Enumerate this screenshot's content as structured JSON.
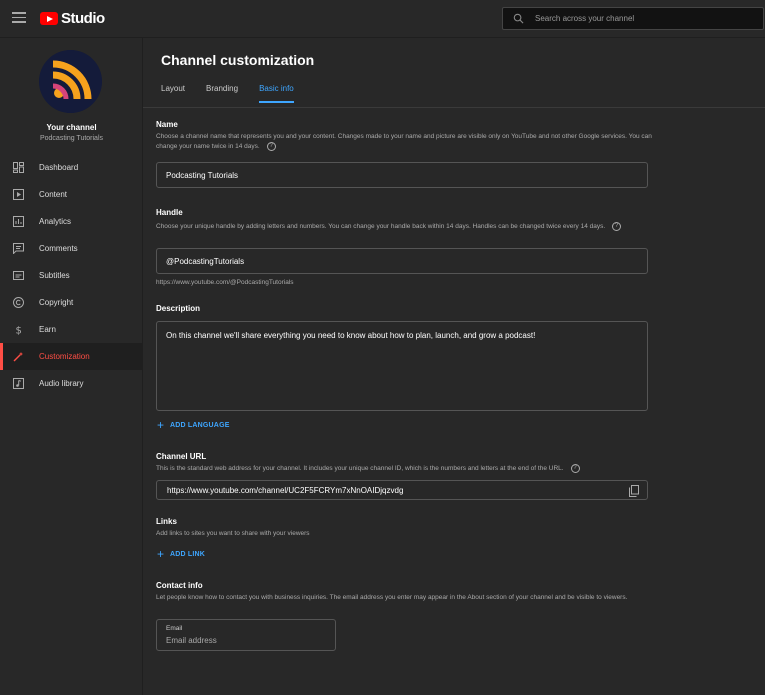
{
  "app": {
    "logo_text": "Studio"
  },
  "search": {
    "placeholder": "Search across your channel"
  },
  "sidebar": {
    "channel_title": "Your channel",
    "channel_name": "Podcasting Tutorials",
    "items": [
      {
        "label": "Dashboard",
        "icon": "dashboard-icon"
      },
      {
        "label": "Content",
        "icon": "content-icon"
      },
      {
        "label": "Analytics",
        "icon": "analytics-icon"
      },
      {
        "label": "Comments",
        "icon": "comments-icon"
      },
      {
        "label": "Subtitles",
        "icon": "subtitles-icon"
      },
      {
        "label": "Copyright",
        "icon": "copyright-icon"
      },
      {
        "label": "Earn",
        "icon": "earn-icon"
      },
      {
        "label": "Customization",
        "icon": "customization-icon",
        "active": true
      },
      {
        "label": "Audio library",
        "icon": "audio-library-icon"
      }
    ]
  },
  "main": {
    "title": "Channel customization",
    "tabs": [
      {
        "label": "Layout"
      },
      {
        "label": "Branding"
      },
      {
        "label": "Basic info",
        "active": true
      }
    ],
    "name": {
      "title": "Name",
      "desc": "Choose a channel name that represents you and your content. Changes made to your name and picture are visible only on YouTube and not other Google services. You can change your name twice in 14 days.",
      "value": "Podcasting Tutorials"
    },
    "handle": {
      "title": "Handle",
      "desc": "Choose your unique handle by adding letters and numbers. You can change your handle back within 14 days. Handles can be changed twice every 14 days.",
      "value": "@PodcastingTutorials",
      "url": "https://www.youtube.com/@PodcastingTutorials"
    },
    "description": {
      "title": "Description",
      "value": "On this channel we'll share everything you need to know about how to plan, launch, and grow a podcast!",
      "add_language": "ADD LANGUAGE"
    },
    "channel_url": {
      "title": "Channel URL",
      "desc": "This is the standard web address for your channel. It includes your unique channel ID, which is the numbers and letters at the end of the URL.",
      "value": "https://www.youtube.com/channel/UC2F5FCRYm7xNnOAIDjqzvdg"
    },
    "links": {
      "title": "Links",
      "desc": "Add links to sites you want to share with your viewers",
      "add_link": "ADD LINK"
    },
    "contact": {
      "title": "Contact info",
      "desc": "Let people know how to contact you with business inquiries. The email address you enter may appear in the About section of your channel and be visible to viewers.",
      "email_label": "Email",
      "email_placeholder": "Email address"
    }
  },
  "colors": {
    "accent_blue": "#3ea6ff",
    "accent_red": "#ff4e45",
    "youtube_red": "#ff0000",
    "avatar_orange": "#f6a21d"
  }
}
